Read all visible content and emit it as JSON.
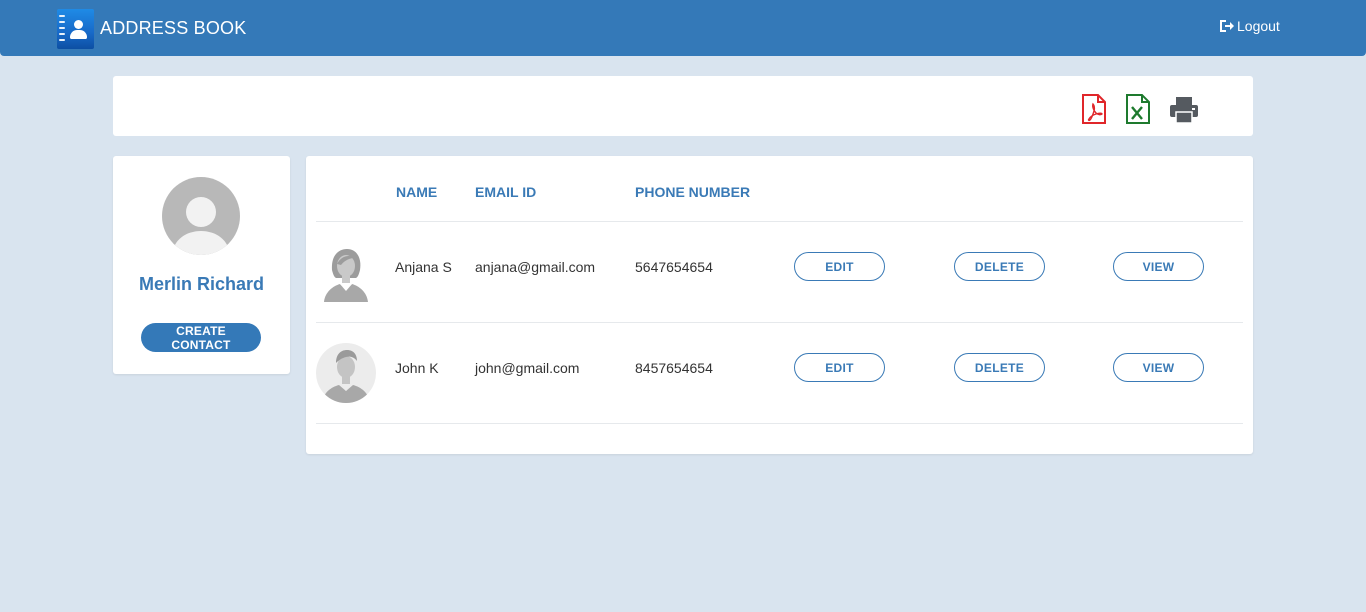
{
  "header": {
    "app_title": "ADDRESS BOOK",
    "logout_label": "Logout",
    "logo_icon": "address-book-icon",
    "logout_icon": "sign-out-icon"
  },
  "toolbar": {
    "export_pdf_icon": "pdf-file-icon",
    "export_excel_icon": "excel-file-icon",
    "print_icon": "printer-icon"
  },
  "profile": {
    "name": "Merlin Richard",
    "create_label": "CREATE CONTACT",
    "avatar_icon": "user-avatar-icon"
  },
  "table": {
    "columns": [
      "NAME",
      "EMAIL ID",
      "PHONE NUMBER"
    ],
    "rows": [
      {
        "name": "Anjana S",
        "email": "anjana@gmail.com",
        "phone": "5647654654",
        "avatar_icon": "female-avatar-icon",
        "edit_label": "EDIT",
        "delete_label": "DELETE",
        "view_label": "VIEW"
      },
      {
        "name": "John K",
        "email": "john@gmail.com",
        "phone": "8457654654",
        "avatar_icon": "male-avatar-icon",
        "edit_label": "EDIT",
        "delete_label": "DELETE",
        "view_label": "VIEW"
      }
    ]
  },
  "colors": {
    "primary": "#3479b8",
    "page_background": "#d9e4ef",
    "pdf_red": "#e0262a",
    "excel_green": "#1e7a2e",
    "print_gray": "#555a60"
  }
}
